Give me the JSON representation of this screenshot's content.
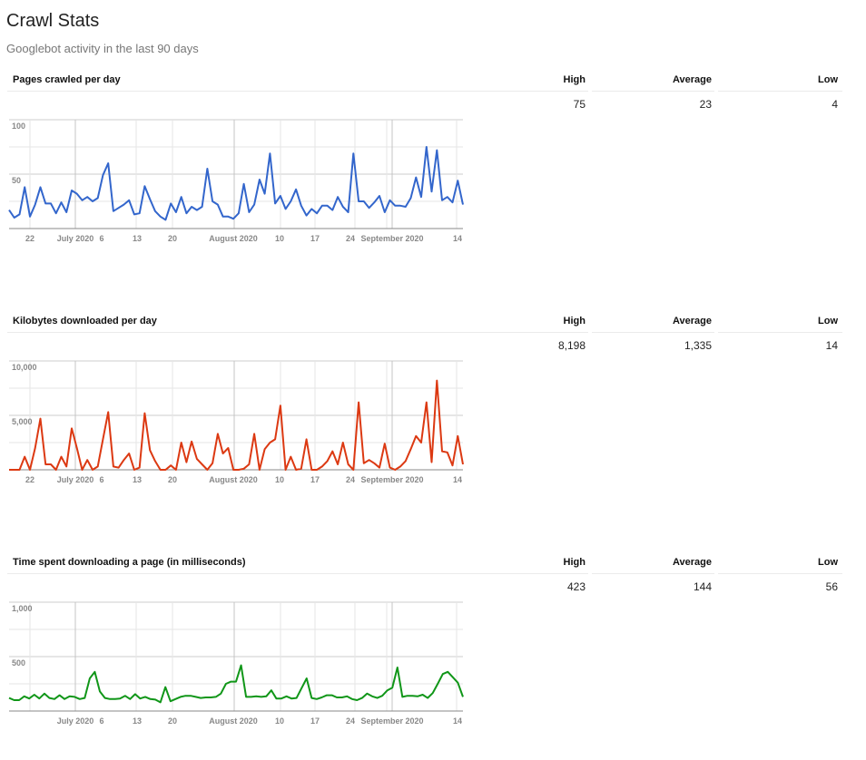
{
  "page": {
    "title": "Crawl Stats",
    "subtitle": "Googlebot activity in the last 90 days"
  },
  "columns": {
    "high": "High",
    "average": "Average",
    "low": "Low"
  },
  "sections": [
    {
      "title": "Pages crawled per day",
      "high": "75",
      "average": "23",
      "low": "4"
    },
    {
      "title": "Kilobytes downloaded per day",
      "high": "8,198",
      "average": "1,335",
      "low": "14"
    },
    {
      "title": "Time spent downloading a page (in milliseconds)",
      "high": "423",
      "average": "144",
      "low": "56"
    }
  ],
  "chart_data": [
    {
      "type": "line",
      "title": "Pages crawled per day",
      "xlabel": "",
      "ylabel": "",
      "ylim": [
        0,
        100
      ],
      "yticks": [
        "100",
        "50"
      ],
      "xtick_labels": [
        "22",
        "July 2020",
        "6",
        "13",
        "20",
        "August 2020",
        "10",
        "17",
        "24",
        "September 2020",
        "14"
      ],
      "color": "#3366cc",
      "grid": true,
      "series": [
        {
          "name": "Pages crawled",
          "values": [
            17,
            10,
            13,
            38,
            11,
            22,
            38,
            23,
            23,
            14,
            24,
            15,
            35,
            32,
            26,
            29,
            25,
            28,
            49,
            60,
            16,
            19,
            22,
            26,
            13,
            14,
            39,
            27,
            16,
            11,
            8,
            23,
            15,
            29,
            14,
            20,
            17,
            20,
            55,
            25,
            22,
            11,
            11,
            9,
            14,
            41,
            15,
            22,
            45,
            32,
            69,
            23,
            30,
            18,
            25,
            36,
            21,
            12,
            18,
            14,
            21,
            21,
            17,
            29,
            20,
            15,
            69,
            25,
            25,
            19,
            24,
            30,
            15,
            26,
            21,
            21,
            20,
            28,
            47,
            29,
            75,
            34,
            72,
            26,
            29,
            24,
            44,
            22
          ]
        }
      ]
    },
    {
      "type": "line",
      "title": "Kilobytes downloaded per day",
      "xlabel": "",
      "ylabel": "",
      "ylim": [
        0,
        10000
      ],
      "yticks": [
        "10,000",
        "5,000"
      ],
      "xtick_labels": [
        "22",
        "July 2020",
        "6",
        "13",
        "20",
        "August 2020",
        "10",
        "17",
        "24",
        "September 2020",
        "14"
      ],
      "color": "#dc3912",
      "grid": true,
      "series": [
        {
          "name": "Kilobytes downloaded",
          "values": [
            0,
            0,
            0,
            1200,
            0,
            2000,
            4700,
            500,
            500,
            0,
            1200,
            300,
            3800,
            2000,
            0,
            900,
            0,
            300,
            2800,
            5300,
            300,
            200,
            900,
            1500,
            0,
            200,
            5200,
            1800,
            800,
            0,
            0,
            400,
            0,
            2500,
            700,
            2600,
            1000,
            500,
            0,
            600,
            3300,
            1500,
            2000,
            0,
            0,
            100,
            500,
            3300,
            0,
            1900,
            2500,
            2800,
            5900,
            0,
            1200,
            0,
            100,
            2800,
            0,
            0,
            300,
            800,
            1700,
            500,
            2500,
            500,
            0,
            6200,
            600,
            900,
            600,
            200,
            2400,
            200,
            0,
            300,
            800,
            1900,
            3100,
            2500,
            6200,
            700,
            8200,
            1700,
            1600,
            400,
            3100,
            500
          ]
        }
      ]
    },
    {
      "type": "line",
      "title": "Time spent downloading a page (in milliseconds)",
      "xlabel": "",
      "ylabel": "",
      "ylim": [
        0,
        1000
      ],
      "yticks": [
        "1,000",
        "500"
      ],
      "xtick_labels": [
        "July 2020",
        "6",
        "13",
        "20",
        "August 2020",
        "10",
        "17",
        "24",
        "September 2020",
        "14"
      ],
      "color": "#109618",
      "grid": true,
      "series": [
        {
          "name": "Time spent",
          "values": [
            120,
            100,
            100,
            135,
            115,
            150,
            115,
            160,
            120,
            110,
            145,
            110,
            135,
            130,
            110,
            120,
            300,
            360,
            180,
            120,
            110,
            110,
            115,
            140,
            110,
            155,
            115,
            130,
            110,
            105,
            80,
            220,
            90,
            110,
            130,
            140,
            140,
            130,
            120,
            125,
            125,
            130,
            160,
            250,
            270,
            270,
            420,
            130,
            130,
            135,
            130,
            135,
            190,
            115,
            115,
            135,
            115,
            120,
            210,
            300,
            120,
            110,
            125,
            145,
            145,
            125,
            125,
            135,
            110,
            100,
            120,
            160,
            135,
            120,
            140,
            190,
            215,
            400,
            130,
            140,
            140,
            135,
            150,
            120,
            165,
            250,
            340,
            360,
            310,
            260,
            130
          ]
        }
      ]
    }
  ]
}
